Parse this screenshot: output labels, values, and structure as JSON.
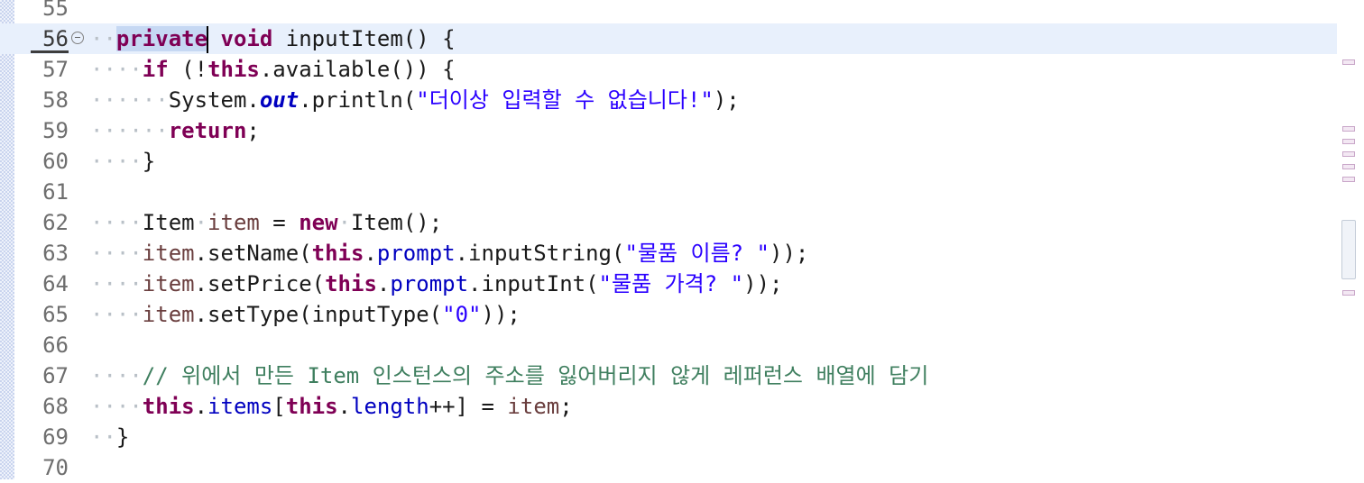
{
  "editor": {
    "lines": [
      {
        "n": "55"
      },
      {
        "n": "56"
      },
      {
        "n": "57"
      },
      {
        "n": "58"
      },
      {
        "n": "59"
      },
      {
        "n": "60"
      },
      {
        "n": "61"
      },
      {
        "n": "62"
      },
      {
        "n": "63"
      },
      {
        "n": "64"
      },
      {
        "n": "65"
      },
      {
        "n": "66"
      },
      {
        "n": "67"
      },
      {
        "n": "68"
      },
      {
        "n": "69"
      },
      {
        "n": "70"
      }
    ],
    "tokens": {
      "private": "private",
      "void": "void",
      "inputItem_decl": "inputItem() {",
      "if": "if",
      "if_open": "(!",
      "this": "this",
      "available": ".available()) {",
      "system": "System.",
      "out": "out",
      "println": ".println(",
      "msg_str": "\"더이상 입력할 수 없습니다!\"",
      "close_semi": ");",
      "return": "return",
      "semi": ";",
      "brace_close": "}",
      "Item": "Item",
      "item": "item",
      "eq": " = ",
      "new": "new",
      "ItemCtor": "Item();",
      "setName": ".setName(",
      "prompt": "prompt",
      "inputString": ".inputString(",
      "name_str": "\"물품 이름? \"",
      "close2": "));",
      "setPrice": ".setPrice(",
      "inputInt": ".inputInt(",
      "price_str": "\"물품 가격? \"",
      "setType": ".setType(inputType(",
      "type_str": "\"0\"",
      "comment": "// 위에서 만든 Item 인스턴스의 주소를 잃어버리지 않게 레퍼런스 배열에 담기",
      "dot": ".",
      "items": "items",
      "bracket_open": "[",
      "length": "length",
      "incr_close": "++]"
    },
    "whitespace_dot": "·"
  }
}
